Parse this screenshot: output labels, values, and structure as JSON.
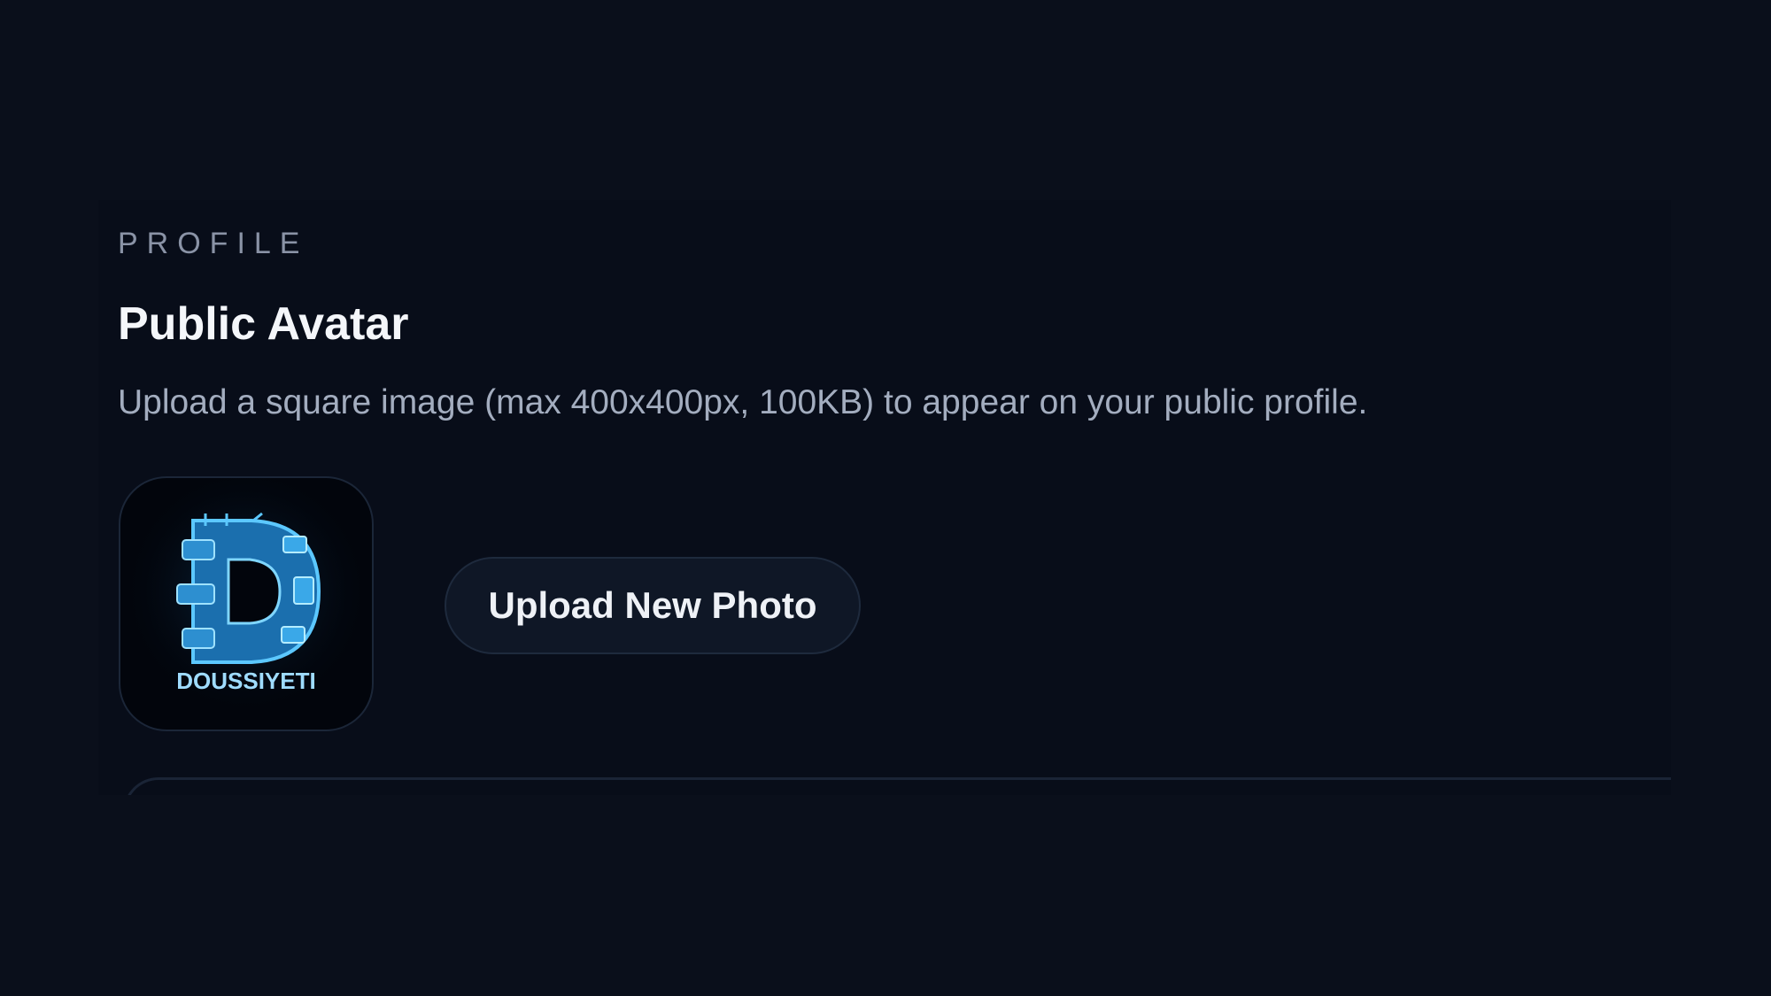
{
  "section": {
    "eyebrow": "PROFILE",
    "title": "Public Avatar",
    "description": "Upload a square image (max 400x400px, 100KB) to appear on your public profile."
  },
  "avatar": {
    "logo_text": "DOUSSIYETI",
    "icon": "letter-d-logo-icon",
    "accent": "#3aa8e8"
  },
  "actions": {
    "upload_label": "Upload New Photo"
  },
  "colors": {
    "background": "#0a0f1b",
    "card": "#080d19",
    "title": "#f4f6fa",
    "muted": "#8a93a6",
    "button_bg": "#0f1726"
  }
}
